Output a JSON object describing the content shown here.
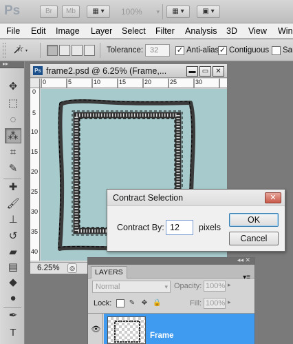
{
  "appbar": {
    "logo": "Ps",
    "bridge_label": "Br",
    "minibridge_label": "Mb",
    "zoom": "100%"
  },
  "menu": [
    "File",
    "Edit",
    "Image",
    "Layer",
    "Select",
    "Filter",
    "Analysis",
    "3D",
    "View",
    "Win"
  ],
  "options": {
    "tolerance_label": "Tolerance:",
    "tolerance_value": "32",
    "antialias_label": "Anti-alias",
    "antialias_checked": true,
    "contiguous_label": "Contiguous",
    "contiguous_checked": true,
    "sample_label": "Sam",
    "sample_checked": false
  },
  "document": {
    "title": "frame2.psd @ 6.25% (Frame,...",
    "badge": "Ps",
    "zoom": "6.25%",
    "ruler_h": [
      "0",
      "5",
      "10",
      "15",
      "20",
      "25",
      "30"
    ],
    "ruler_v": [
      "0",
      "5",
      "10",
      "15",
      "20",
      "25",
      "30",
      "35",
      "40"
    ]
  },
  "dialog": {
    "title": "Contract Selection",
    "contract_label": "Contract By:",
    "contract_value": "12",
    "unit": "pixels",
    "ok": "OK",
    "cancel": "Cancel"
  },
  "layers": {
    "tab": "LAYERS",
    "blend_mode": "Normal",
    "opacity_label": "Opacity:",
    "opacity_value": "100%",
    "lock_label": "Lock:",
    "fill_label": "Fill:",
    "fill_value": "100%",
    "layer_name": "Frame"
  },
  "colors": {
    "canvas": "#a7cbcd",
    "selected_layer": "#3f9bf0",
    "frame_stroke": "#3a3a3a"
  }
}
